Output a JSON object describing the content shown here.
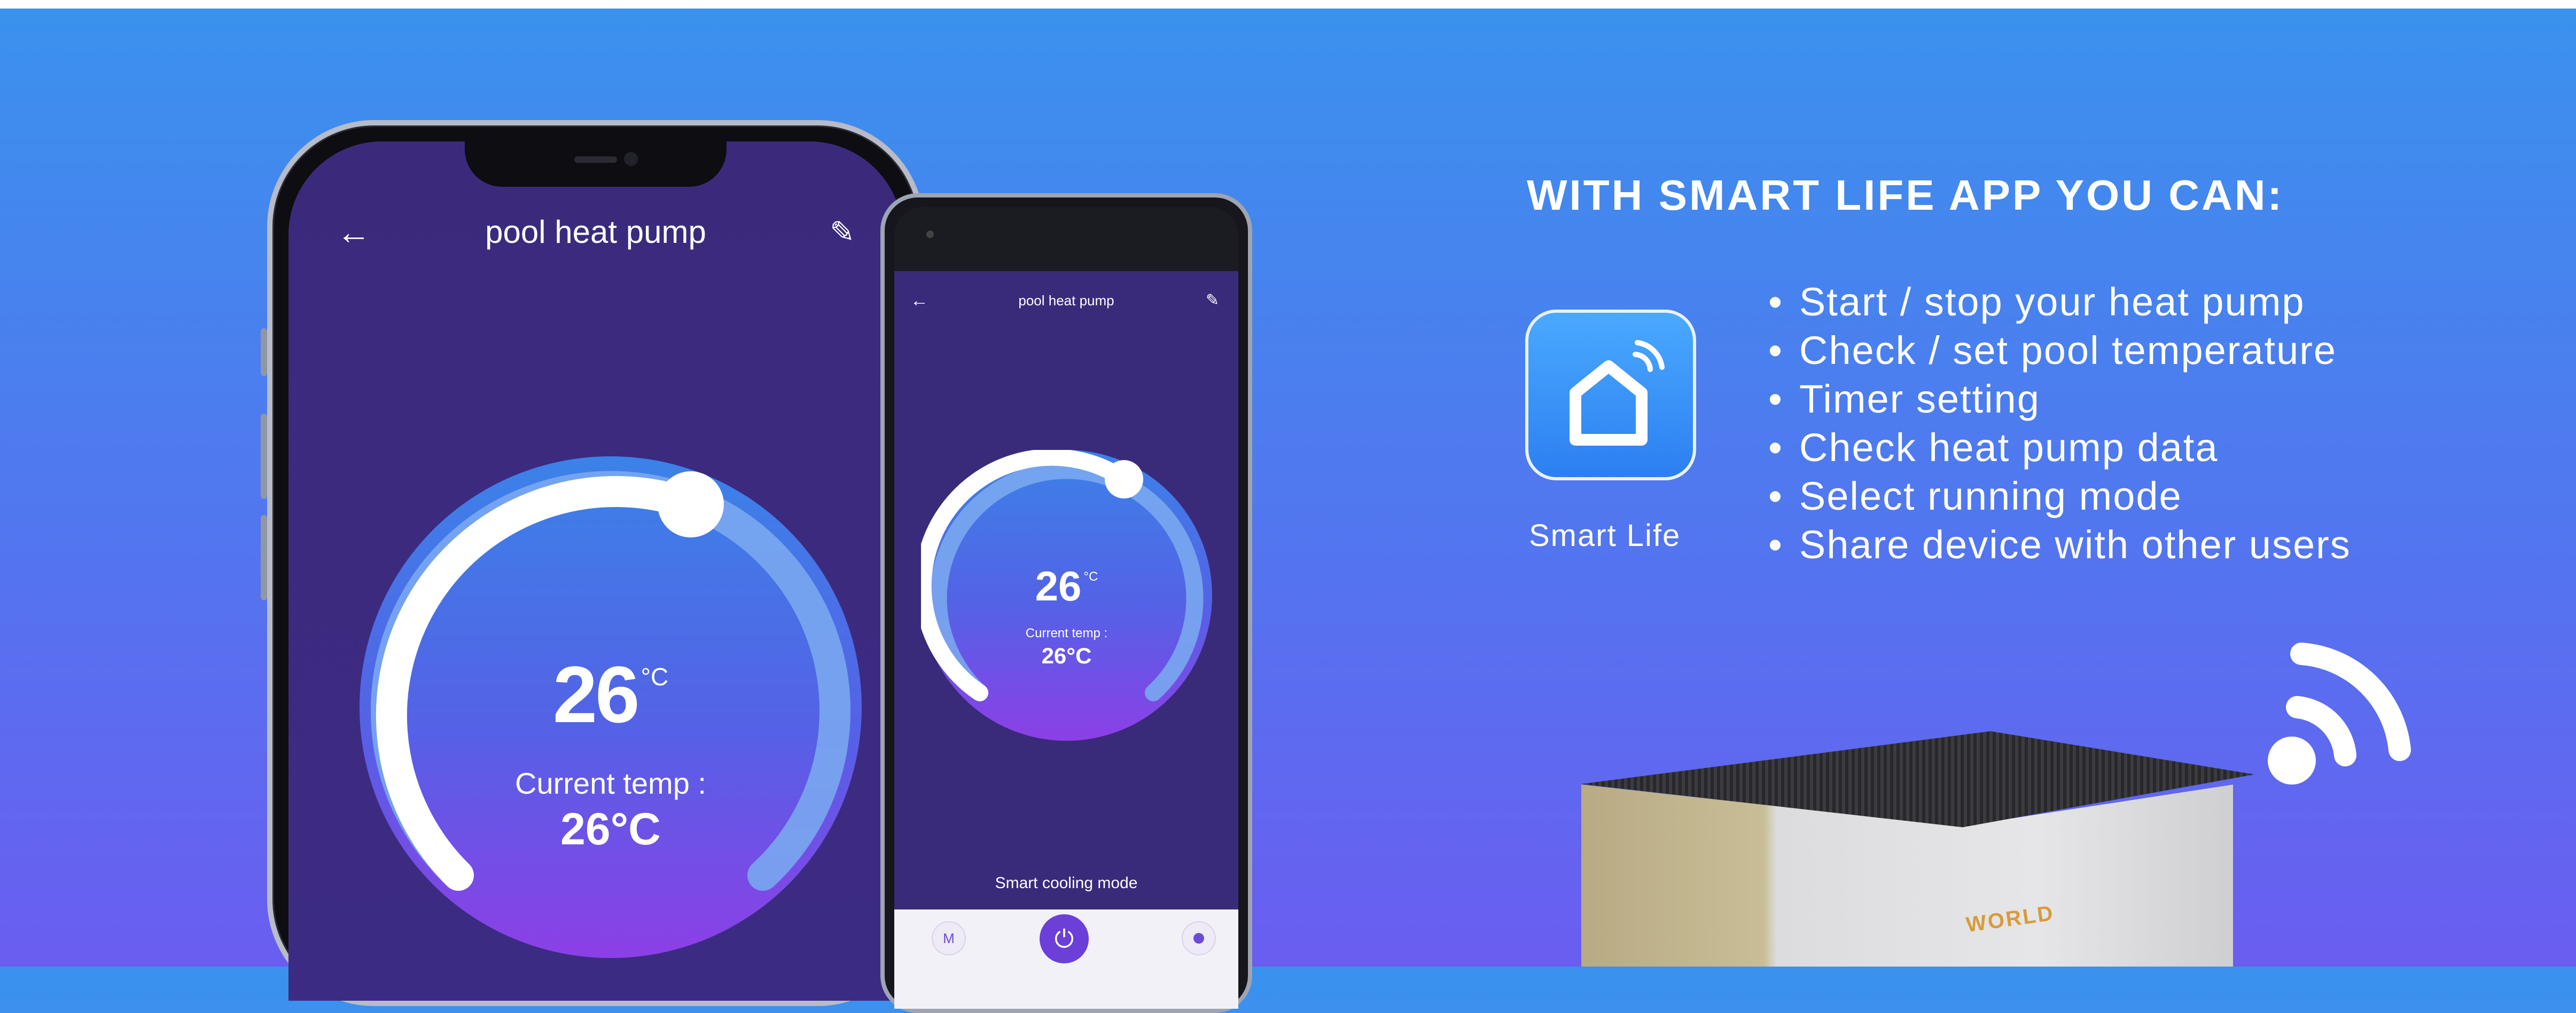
{
  "phone_big": {
    "app_title": "pool heat pump",
    "back_icon": "←",
    "edit_icon": "✎",
    "set_temperature": "26",
    "unit": "°C",
    "current_label": "Current temp :",
    "current_value": "26°C"
  },
  "phone_small": {
    "app_title": "pool heat pump",
    "back_icon": "←",
    "edit_icon": "✎",
    "set_temperature": "26",
    "unit": "°C",
    "current_label": "Current temp :",
    "current_value": "26°C",
    "mode_label": "Smart cooling mode",
    "mode_button": "M",
    "power_icon": "⏻"
  },
  "panel": {
    "headline": "WITH SMART LIFE APP YOU CAN:",
    "app_name": "Smart Life",
    "features": [
      "Start / stop your heat pump",
      "Check / set pool temperature",
      "Timer setting",
      "Check heat pump data",
      "Select running mode",
      "Share device with other users"
    ]
  },
  "product": {
    "logo_text": "WORLD"
  },
  "colors": {
    "accent": "#6b3fd8",
    "dial_blue": "#3b82e8",
    "dial_purple": "#8c3fe6"
  }
}
